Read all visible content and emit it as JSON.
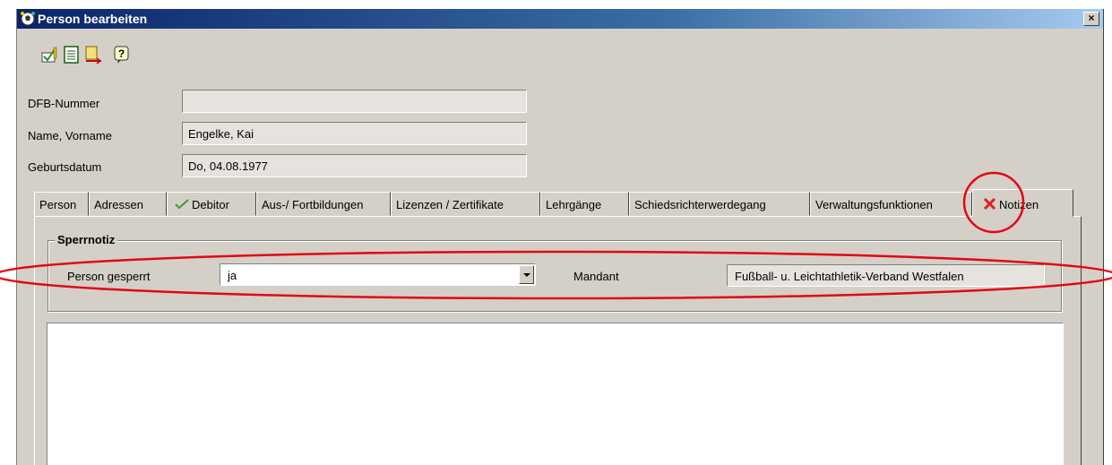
{
  "window": {
    "title": "Person bearbeiten",
    "close_label": "×"
  },
  "toolbar": {
    "icons": [
      "save-check-icon",
      "document-icon",
      "export-icon",
      "help-icon"
    ]
  },
  "fields": {
    "dfb_nummer": {
      "label": "DFB-Nummer",
      "value": ""
    },
    "name": {
      "label": "Name, Vorname",
      "value": "Engelke, Kai"
    },
    "geburtsdatum": {
      "label": "Geburtsdatum",
      "value": "Do, 04.08.1977"
    }
  },
  "tabs": [
    {
      "label": "Person"
    },
    {
      "label": "Adressen"
    },
    {
      "label": "Debitor",
      "icon": "checkmark-icon"
    },
    {
      "label": "Aus-/ Fortbildungen"
    },
    {
      "label": "Lizenzen / Zertifikate"
    },
    {
      "label": "Lehrgänge"
    },
    {
      "label": "Schiedsrichterwerdegang"
    },
    {
      "label": "Verwaltungsfunktionen"
    },
    {
      "label": "Notizen",
      "icon": "red-x-icon",
      "active": true
    }
  ],
  "sperrnotiz": {
    "title": "Sperrnotiz",
    "person_gesperrt_label": "Person gesperrt",
    "person_gesperrt_value": "ja",
    "mandant_label": "Mandant",
    "mandant_value": "Fußball- u. Leichtathletik-Verband Westfalen"
  },
  "notes": {
    "value": ""
  },
  "colors": {
    "titlebar": "#0a246a",
    "annotation": "#e30613",
    "window": "#d4d0c8"
  }
}
